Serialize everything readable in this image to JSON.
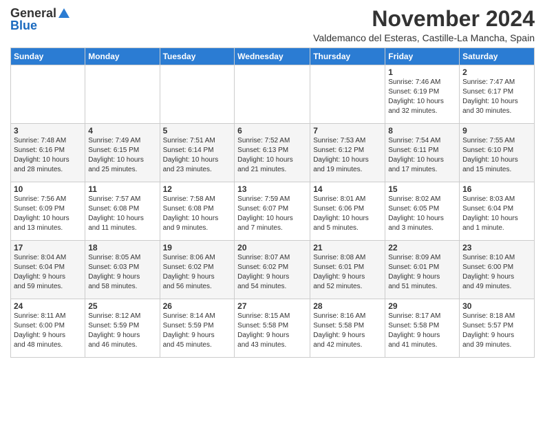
{
  "logo": {
    "general": "General",
    "blue": "Blue"
  },
  "title": "November 2024",
  "subtitle": "Valdemanco del Esteras, Castille-La Mancha, Spain",
  "headers": [
    "Sunday",
    "Monday",
    "Tuesday",
    "Wednesday",
    "Thursday",
    "Friday",
    "Saturday"
  ],
  "weeks": [
    [
      {
        "day": "",
        "info": ""
      },
      {
        "day": "",
        "info": ""
      },
      {
        "day": "",
        "info": ""
      },
      {
        "day": "",
        "info": ""
      },
      {
        "day": "",
        "info": ""
      },
      {
        "day": "1",
        "info": "Sunrise: 7:46 AM\nSunset: 6:19 PM\nDaylight: 10 hours\nand 32 minutes."
      },
      {
        "day": "2",
        "info": "Sunrise: 7:47 AM\nSunset: 6:17 PM\nDaylight: 10 hours\nand 30 minutes."
      }
    ],
    [
      {
        "day": "3",
        "info": "Sunrise: 7:48 AM\nSunset: 6:16 PM\nDaylight: 10 hours\nand 28 minutes."
      },
      {
        "day": "4",
        "info": "Sunrise: 7:49 AM\nSunset: 6:15 PM\nDaylight: 10 hours\nand 25 minutes."
      },
      {
        "day": "5",
        "info": "Sunrise: 7:51 AM\nSunset: 6:14 PM\nDaylight: 10 hours\nand 23 minutes."
      },
      {
        "day": "6",
        "info": "Sunrise: 7:52 AM\nSunset: 6:13 PM\nDaylight: 10 hours\nand 21 minutes."
      },
      {
        "day": "7",
        "info": "Sunrise: 7:53 AM\nSunset: 6:12 PM\nDaylight: 10 hours\nand 19 minutes."
      },
      {
        "day": "8",
        "info": "Sunrise: 7:54 AM\nSunset: 6:11 PM\nDaylight: 10 hours\nand 17 minutes."
      },
      {
        "day": "9",
        "info": "Sunrise: 7:55 AM\nSunset: 6:10 PM\nDaylight: 10 hours\nand 15 minutes."
      }
    ],
    [
      {
        "day": "10",
        "info": "Sunrise: 7:56 AM\nSunset: 6:09 PM\nDaylight: 10 hours\nand 13 minutes."
      },
      {
        "day": "11",
        "info": "Sunrise: 7:57 AM\nSunset: 6:08 PM\nDaylight: 10 hours\nand 11 minutes."
      },
      {
        "day": "12",
        "info": "Sunrise: 7:58 AM\nSunset: 6:08 PM\nDaylight: 10 hours\nand 9 minutes."
      },
      {
        "day": "13",
        "info": "Sunrise: 7:59 AM\nSunset: 6:07 PM\nDaylight: 10 hours\nand 7 minutes."
      },
      {
        "day": "14",
        "info": "Sunrise: 8:01 AM\nSunset: 6:06 PM\nDaylight: 10 hours\nand 5 minutes."
      },
      {
        "day": "15",
        "info": "Sunrise: 8:02 AM\nSunset: 6:05 PM\nDaylight: 10 hours\nand 3 minutes."
      },
      {
        "day": "16",
        "info": "Sunrise: 8:03 AM\nSunset: 6:04 PM\nDaylight: 10 hours\nand 1 minute."
      }
    ],
    [
      {
        "day": "17",
        "info": "Sunrise: 8:04 AM\nSunset: 6:04 PM\nDaylight: 9 hours\nand 59 minutes."
      },
      {
        "day": "18",
        "info": "Sunrise: 8:05 AM\nSunset: 6:03 PM\nDaylight: 9 hours\nand 58 minutes."
      },
      {
        "day": "19",
        "info": "Sunrise: 8:06 AM\nSunset: 6:02 PM\nDaylight: 9 hours\nand 56 minutes."
      },
      {
        "day": "20",
        "info": "Sunrise: 8:07 AM\nSunset: 6:02 PM\nDaylight: 9 hours\nand 54 minutes."
      },
      {
        "day": "21",
        "info": "Sunrise: 8:08 AM\nSunset: 6:01 PM\nDaylight: 9 hours\nand 52 minutes."
      },
      {
        "day": "22",
        "info": "Sunrise: 8:09 AM\nSunset: 6:01 PM\nDaylight: 9 hours\nand 51 minutes."
      },
      {
        "day": "23",
        "info": "Sunrise: 8:10 AM\nSunset: 6:00 PM\nDaylight: 9 hours\nand 49 minutes."
      }
    ],
    [
      {
        "day": "24",
        "info": "Sunrise: 8:11 AM\nSunset: 6:00 PM\nDaylight: 9 hours\nand 48 minutes."
      },
      {
        "day": "25",
        "info": "Sunrise: 8:12 AM\nSunset: 5:59 PM\nDaylight: 9 hours\nand 46 minutes."
      },
      {
        "day": "26",
        "info": "Sunrise: 8:14 AM\nSunset: 5:59 PM\nDaylight: 9 hours\nand 45 minutes."
      },
      {
        "day": "27",
        "info": "Sunrise: 8:15 AM\nSunset: 5:58 PM\nDaylight: 9 hours\nand 43 minutes."
      },
      {
        "day": "28",
        "info": "Sunrise: 8:16 AM\nSunset: 5:58 PM\nDaylight: 9 hours\nand 42 minutes."
      },
      {
        "day": "29",
        "info": "Sunrise: 8:17 AM\nSunset: 5:58 PM\nDaylight: 9 hours\nand 41 minutes."
      },
      {
        "day": "30",
        "info": "Sunrise: 8:18 AM\nSunset: 5:57 PM\nDaylight: 9 hours\nand 39 minutes."
      }
    ]
  ]
}
